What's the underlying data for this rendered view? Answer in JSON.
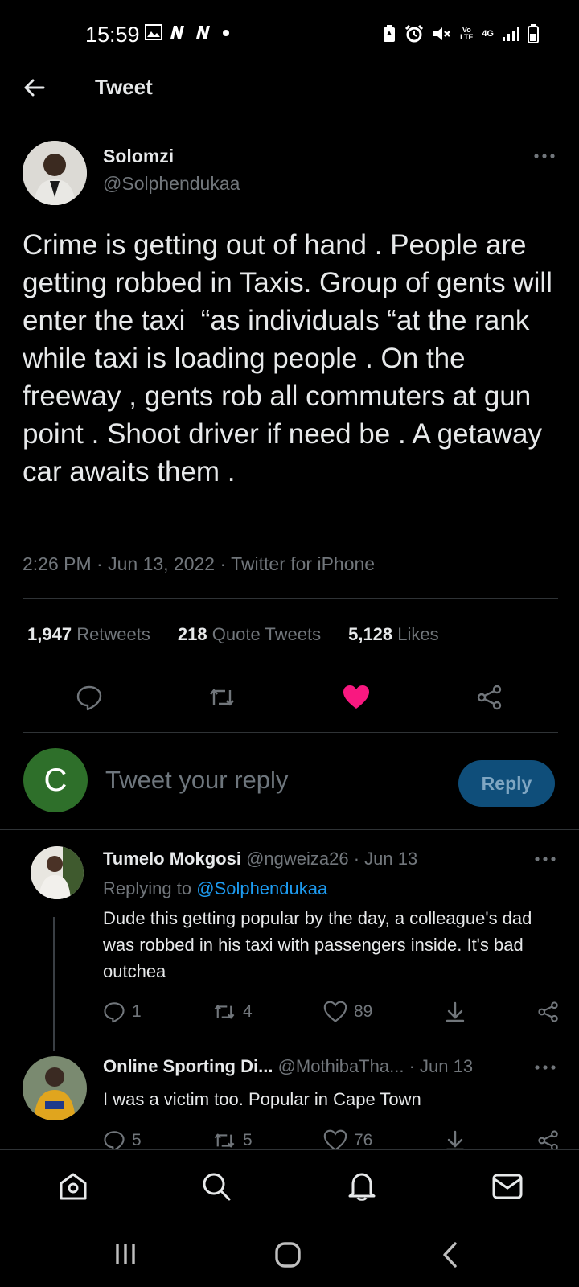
{
  "status_bar": {
    "time": "15:59",
    "left_icons": [
      "image-icon",
      "netflix-icon",
      "netflix-icon",
      "dot-icon"
    ],
    "right_icons": [
      "battery-saver-icon",
      "alarm-icon",
      "mute-icon",
      "volte-icon",
      "4g-icon",
      "signal-icon",
      "battery-icon"
    ],
    "volte_label": "Vo LTE",
    "network_label": "4G"
  },
  "header": {
    "title": "Tweet"
  },
  "tweet": {
    "author_name": "Solomzi",
    "author_handle": "@Solphendukaa",
    "text": "Crime is getting out of hand . People are getting robbed in Taxis. Group of gents will enter the taxi  “as individuals “at the rank while taxi is loading people . On the freeway , gents rob all commuters at gun point . Shoot driver if need be . A getaway car awaits them .",
    "meta": "2:26 PM · Jun 13, 2022 · Twitter for iPhone",
    "stats": [
      {
        "count": "1,947",
        "label": "Retweets"
      },
      {
        "count": "218",
        "label": "Quote Tweets"
      },
      {
        "count": "5,128",
        "label": "Likes"
      }
    ],
    "actions": [
      "reply-icon",
      "retweet-icon",
      "like-filled-icon",
      "share-icon"
    ],
    "like_color": "#f91880"
  },
  "composer": {
    "avatar_letter": "C",
    "avatar_color": "#2e6f2a",
    "placeholder": "Tweet your reply",
    "reply_label": "Reply"
  },
  "replies": [
    {
      "name": "Tumelo Mokgosi",
      "handle": "@ngweiza26",
      "date": "· Jun 13",
      "replying_to_prefix": "Replying to",
      "replying_to": "@Solphendukaa",
      "text": "Dude this getting popular by the day, a colleague's dad was robbed in his taxi with passengers inside. It's bad outchea",
      "replies": "1",
      "retweets": "4",
      "likes": "89"
    },
    {
      "name": "Online Sporting Di...",
      "handle": "@MothibaTha...",
      "date": "· Jun 13",
      "text": "I was a victim too. Popular in Cape Town",
      "replies": "5",
      "retweets": "5",
      "likes": "76"
    }
  ],
  "bottom_nav": [
    "home-icon",
    "search-icon",
    "notifications-icon",
    "messages-icon"
  ],
  "system_nav": [
    "recent-apps-icon",
    "home-circle-icon",
    "back-icon"
  ],
  "colors": {
    "accent": "#1d9bf0",
    "reply_button": "#0f4e7a",
    "text_secondary": "#71767b"
  }
}
